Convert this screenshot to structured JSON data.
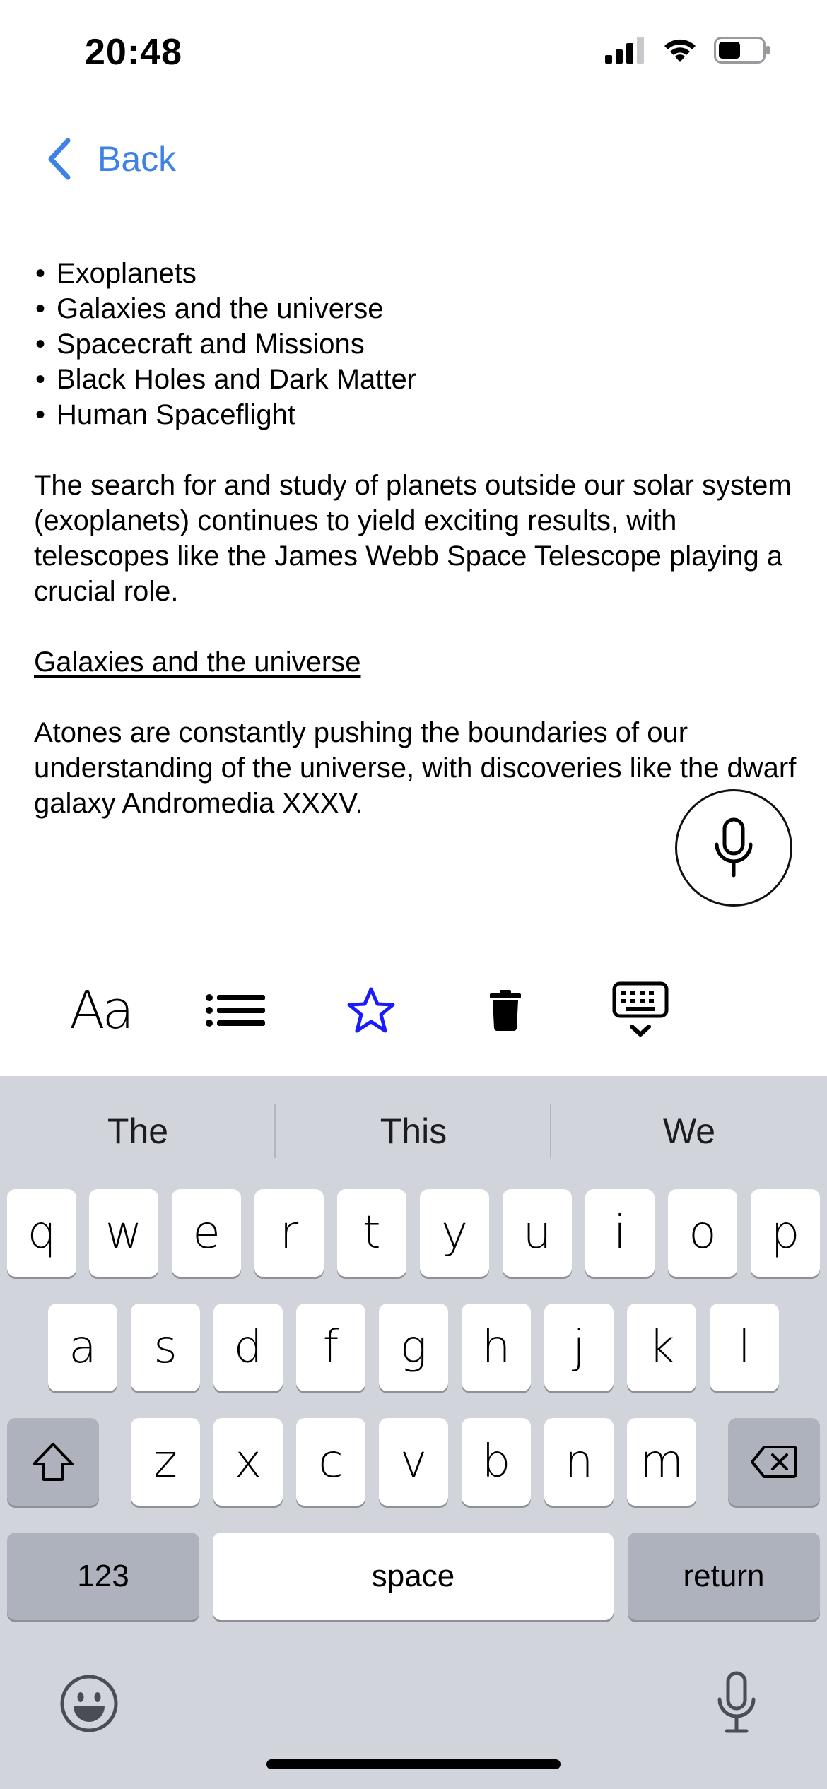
{
  "status_bar": {
    "time": "20:48",
    "icons": [
      "cellular-signal-icon",
      "wifi-icon",
      "battery-icon"
    ]
  },
  "nav": {
    "back_label": "Back",
    "accent_color": "#3f82e6"
  },
  "note": {
    "bullets": [
      "Exoplanets",
      "Galaxies and the universe",
      "Spacecraft and Missions",
      "Black Holes and Dark Matter",
      "Human Spaceflight"
    ],
    "paragraph_1": "The search for and study of planets outside our solar system (exoplanets) continues to yield exciting results, with telescopes like the James Webb Space Telescope playing a crucial role.",
    "heading_2": "Galaxies and the universe",
    "paragraph_2": "Atones are constantly pushing the boundaries of our understanding of the universe, with discoveries like the dwarf galaxy Andromedia XXXV."
  },
  "toolbar": {
    "items": [
      {
        "icon": "text-format-icon",
        "label": "Aa"
      },
      {
        "icon": "list-icon"
      },
      {
        "icon": "star-icon",
        "color": "#1a1aff"
      },
      {
        "icon": "trash-icon"
      },
      {
        "icon": "keyboard-dismiss-icon"
      }
    ]
  },
  "keyboard": {
    "suggestions": [
      "The",
      "This",
      "We"
    ],
    "row1": [
      "q",
      "w",
      "e",
      "r",
      "t",
      "y",
      "u",
      "i",
      "o",
      "p"
    ],
    "row2": [
      "a",
      "s",
      "d",
      "f",
      "g",
      "h",
      "j",
      "k",
      "l"
    ],
    "row3": [
      "z",
      "x",
      "c",
      "v",
      "b",
      "n",
      "m"
    ],
    "numbers_label": "123",
    "space_label": "space",
    "return_label": "return",
    "background_color": "#d1d4db"
  }
}
